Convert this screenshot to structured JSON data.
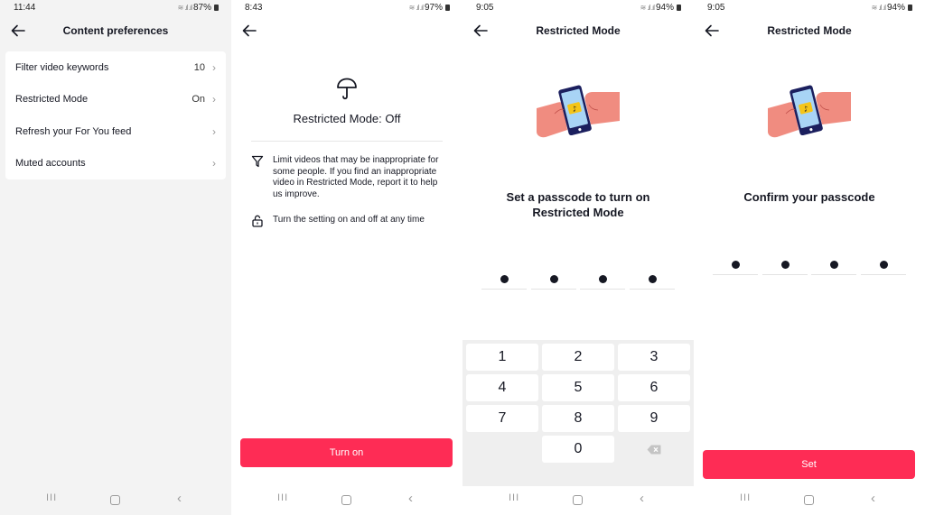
{
  "panels": [
    {
      "status": {
        "time": "11:44",
        "battery": "87%"
      },
      "nav": {
        "title": "Content preferences"
      },
      "list": [
        {
          "label": "Filter video keywords",
          "value": "10"
        },
        {
          "label": "Restricted Mode",
          "value": "On"
        },
        {
          "label": "Refresh your For You feed",
          "value": ""
        },
        {
          "label": "Muted accounts",
          "value": ""
        }
      ]
    },
    {
      "status": {
        "time": "8:43",
        "battery": "97%"
      },
      "nav": {
        "title": ""
      },
      "title": "Restricted Mode: Off",
      "info": [
        {
          "icon": "filter-icon",
          "text": "Limit videos that may be inappropriate for some people. If you find an inappropriate video in Restricted Mode, report it to help us improve."
        },
        {
          "icon": "lock-icon",
          "text": "Turn the setting on and off at any time"
        }
      ],
      "button": "Turn on"
    },
    {
      "status": {
        "time": "9:05",
        "battery": "94%"
      },
      "nav": {
        "title": "Restricted Mode"
      },
      "heading_line1": "Set a passcode to turn on",
      "heading_line2": "Restricted Mode",
      "pin_filled": 4,
      "keypad": [
        "1",
        "2",
        "3",
        "4",
        "5",
        "6",
        "7",
        "8",
        "9",
        "",
        "0",
        "backspace"
      ]
    },
    {
      "status": {
        "time": "9:05",
        "battery": "94%"
      },
      "nav": {
        "title": "Restricted Mode"
      },
      "heading": "Confirm your passcode",
      "pin_filled": 4,
      "button": "Set"
    }
  ],
  "colors": {
    "accent": "#fe2c55",
    "text": "#161823",
    "illustration_hand": "#f08c80",
    "illustration_phone": "#1b1f5e",
    "illustration_screen": "#a8d4f5",
    "illustration_logo_bg": "#f5c518"
  }
}
